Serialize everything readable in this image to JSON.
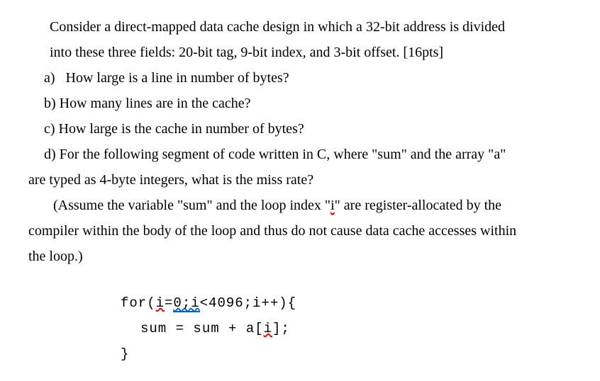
{
  "intro_line1": "Consider a direct-mapped data cache design in which a 32-bit address is divided",
  "intro_line2": "into these three fields: 20-bit tag, 9-bit index, and 3-bit offset. [16pts]",
  "item_a_prefix": "a)",
  "item_a_text": "How large is a line in number of bytes?",
  "item_b": "b) How many lines are in the cache?",
  "item_c": "c) How large is the cache in number of bytes?",
  "item_d_line1": "d) For the following segment of code written in C, where \"sum\" and the array \"a\"",
  "item_d_line2": "are typed as 4-byte integers, what is the miss rate?",
  "assume_start": "(Assume the variable \"sum\" and the loop index \"",
  "assume_i": "i",
  "assume_mid": "\" are register-allocated by the",
  "assume_line2": "compiler within the body of the loop and thus do not cause data cache accesses within",
  "assume_line3": "the loop.)",
  "code": {
    "for_start": "for(",
    "for_i": "i",
    "for_eq": "=",
    "for_0i": "0;i",
    "for_rest": "<4096;i++){",
    "body_start": "sum = sum + a[",
    "body_i": "i",
    "body_end": "];",
    "close": "}"
  }
}
